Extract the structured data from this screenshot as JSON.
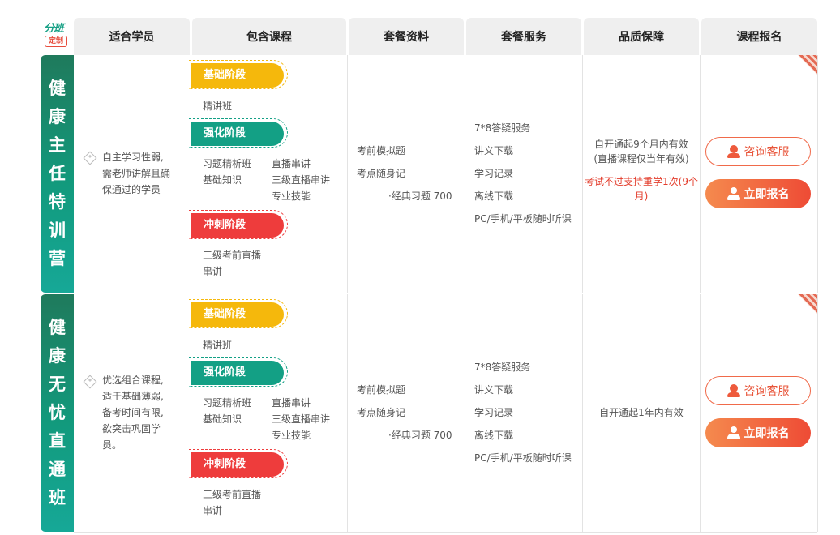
{
  "logo": {
    "top": "分班",
    "bottom": "定制"
  },
  "headers": [
    "适合学员",
    "包含课程",
    "套餐资料",
    "套餐服务",
    "品质保障",
    "课程报名"
  ],
  "rows": [
    {
      "name": [
        "健",
        "康",
        "主",
        "任",
        "特",
        "训",
        "营"
      ],
      "description": [
        "自主学习性弱,",
        "需老师讲解且确",
        "保通过的学员"
      ],
      "stages": {
        "basic": {
          "label": "基础阶段",
          "items": [
            "精讲班"
          ]
        },
        "strengthen": {
          "label": "强化阶段",
          "col1": [
            "习题精析班",
            "基础知识"
          ],
          "col2": [
            "直播串讲",
            "三级直播串讲",
            "专业技能"
          ]
        },
        "sprint": {
          "label": "冲刺阶段",
          "items": [
            "三级考前直播",
            "串讲"
          ]
        }
      },
      "materials": [
        "考前模拟题",
        "考点随身记",
        "·经典习题 700"
      ],
      "services": [
        "7*8答疑服务",
        "讲义下载",
        "学习记录",
        "离线下载",
        "PC/手机/平板随时听课"
      ],
      "guarantee": [
        "自开通起9个月内有效",
        "(直播课程仅当年有效)"
      ],
      "guarantee_red": [
        "考试不过支持重学1次(9个",
        "月)"
      ],
      "consult_label": "咨询客服",
      "enroll_label": "立即报名"
    },
    {
      "name": [
        "健",
        "康",
        "无",
        "忧",
        "直",
        "通",
        "班"
      ],
      "description": [
        "优选组合课程,",
        "适于基础薄弱,",
        "备考时间有限,",
        "欲突击巩固学",
        "员。"
      ],
      "stages": {
        "basic": {
          "label": "基础阶段",
          "items": [
            "精讲班"
          ]
        },
        "strengthen": {
          "label": "强化阶段",
          "col1": [
            "习题精析班",
            "基础知识"
          ],
          "col2": [
            "直播串讲",
            "三级直播串讲",
            "专业技能"
          ]
        },
        "sprint": {
          "label": "冲刺阶段",
          "items": [
            "三级考前直播",
            "串讲"
          ]
        }
      },
      "materials": [
        "考前模拟题",
        "考点随身记",
        "·经典习题 700"
      ],
      "services": [
        "7*8答疑服务",
        "讲义下载",
        "学习记录",
        "离线下载",
        "PC/手机/平板随时听课"
      ],
      "guarantee": [
        "自开通起1年内有效"
      ],
      "guarantee_red": [],
      "consult_label": "咨询客服",
      "enroll_label": "立即报名"
    }
  ]
}
